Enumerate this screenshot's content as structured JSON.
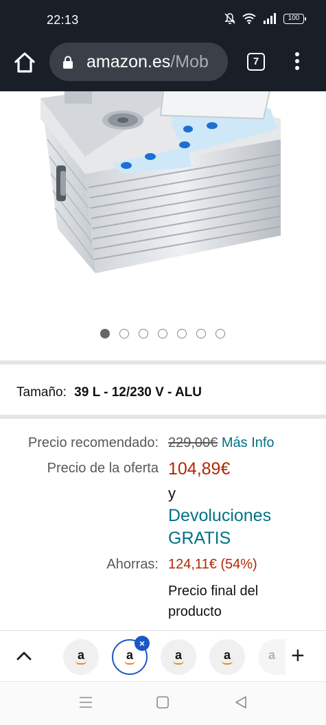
{
  "status_bar": {
    "time": "22:13",
    "battery": "100"
  },
  "browser": {
    "url_host": "amazon.es",
    "url_path": "/Mob",
    "tab_count": "7"
  },
  "product": {
    "image_icon": "cooler-box-photo",
    "carousel_count": 7,
    "carousel_active": 0
  },
  "variant": {
    "label": "Tamaño:",
    "value": "39 L - 12/230 V - ALU"
  },
  "pricing": {
    "recommended_label": "Precio recomendado:",
    "recommended_price": "229,00€",
    "more_info": "Más Info",
    "offer_label": "Precio de la oferta",
    "offer_price": "104,89€",
    "and_text": "y",
    "returns_line1": "Devoluciones",
    "returns_line2": "GRATIS",
    "savings_label": "Ahorras:",
    "savings_value": "124,11€ (54%)",
    "final_line1": "Precio final del",
    "final_line2": "producto"
  },
  "tab_strip": {
    "tab_letter": "a",
    "plus": "+"
  },
  "colors": {
    "chrome": "#1a1f27",
    "link": "#007185",
    "price_red": "#b12704",
    "active_tab": "#1a56c6"
  }
}
